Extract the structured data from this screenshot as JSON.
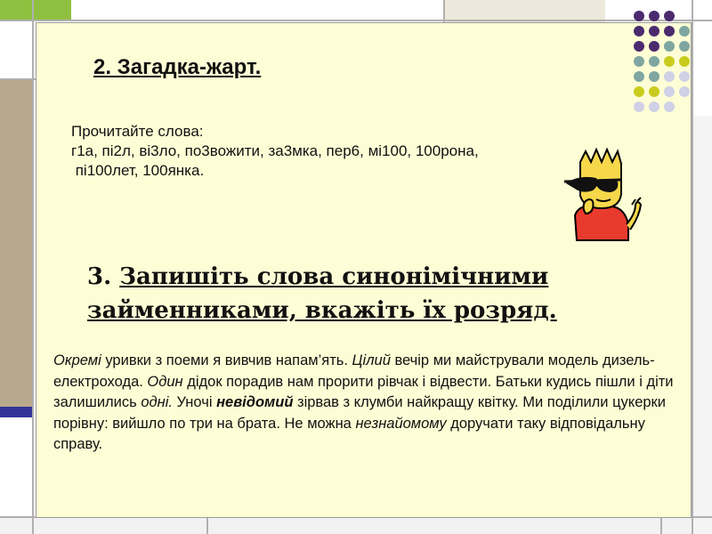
{
  "slide": {
    "title": "2. Загадка-жарт.",
    "words_intro": "Прочитайте слова:",
    "words_line1": "г1а, пі2л, ві3ло, по3вожити, за3мка, пер6, мі100, 100рона,",
    "words_line2": " пі100лет, 100янка.",
    "task_number": "3.",
    "task_text": "Запишіть слова синонімічними займенниками, вкажіть їх розряд.",
    "paragraph": [
      {
        "t": "Окремі",
        "s": "i"
      },
      {
        "t": " уривки з поеми я вивчив напам’ять. ",
        "s": ""
      },
      {
        "t": "Цілий",
        "s": "i"
      },
      {
        "t": " вечір ми майстрували модель дизель-електрохода. ",
        "s": ""
      },
      {
        "t": "Один",
        "s": "i"
      },
      {
        "t": " дідок порадив нам прорити рівчак і відвести. Батьки кудись пішли і діти залишились ",
        "s": ""
      },
      {
        "t": "одні.",
        "s": "i"
      },
      {
        "t": " Уночі ",
        "s": ""
      },
      {
        "t": "невідомий",
        "s": "bi"
      },
      {
        "t": " зірвав з клумби найкращу квітку. Ми поділили цукерки порівну: вийшло по три на брата. Не можна ",
        "s": ""
      },
      {
        "t": "незнайомому",
        "s": "i"
      },
      {
        "t": " доручати таку відповідальну справу.",
        "s": ""
      }
    ]
  },
  "colors": {
    "panel": "#fefed6",
    "accent_green": "#8fbf3f",
    "accent_purple": "#4b2a6e",
    "accent_teal": "#7fa6a0",
    "accent_yellow": "#c9cc1e",
    "accent_lavender": "#d0d0e6",
    "accent_brown": "#b9a98c",
    "accent_navy": "#333399"
  },
  "decoration": {
    "dot_rows": [
      [
        "purple",
        "purple",
        "purple",
        "none"
      ],
      [
        "purple",
        "purple",
        "purple",
        "teal"
      ],
      [
        "purple",
        "purple",
        "teal",
        "teal"
      ],
      [
        "teal",
        "teal",
        "yellow",
        "yellow"
      ],
      [
        "teal",
        "teal",
        "lavender",
        "lavender"
      ],
      [
        "yellow",
        "yellow",
        "lavender",
        "lavender"
      ],
      [
        "lavender",
        "lavender",
        "lavender",
        "none"
      ]
    ]
  }
}
